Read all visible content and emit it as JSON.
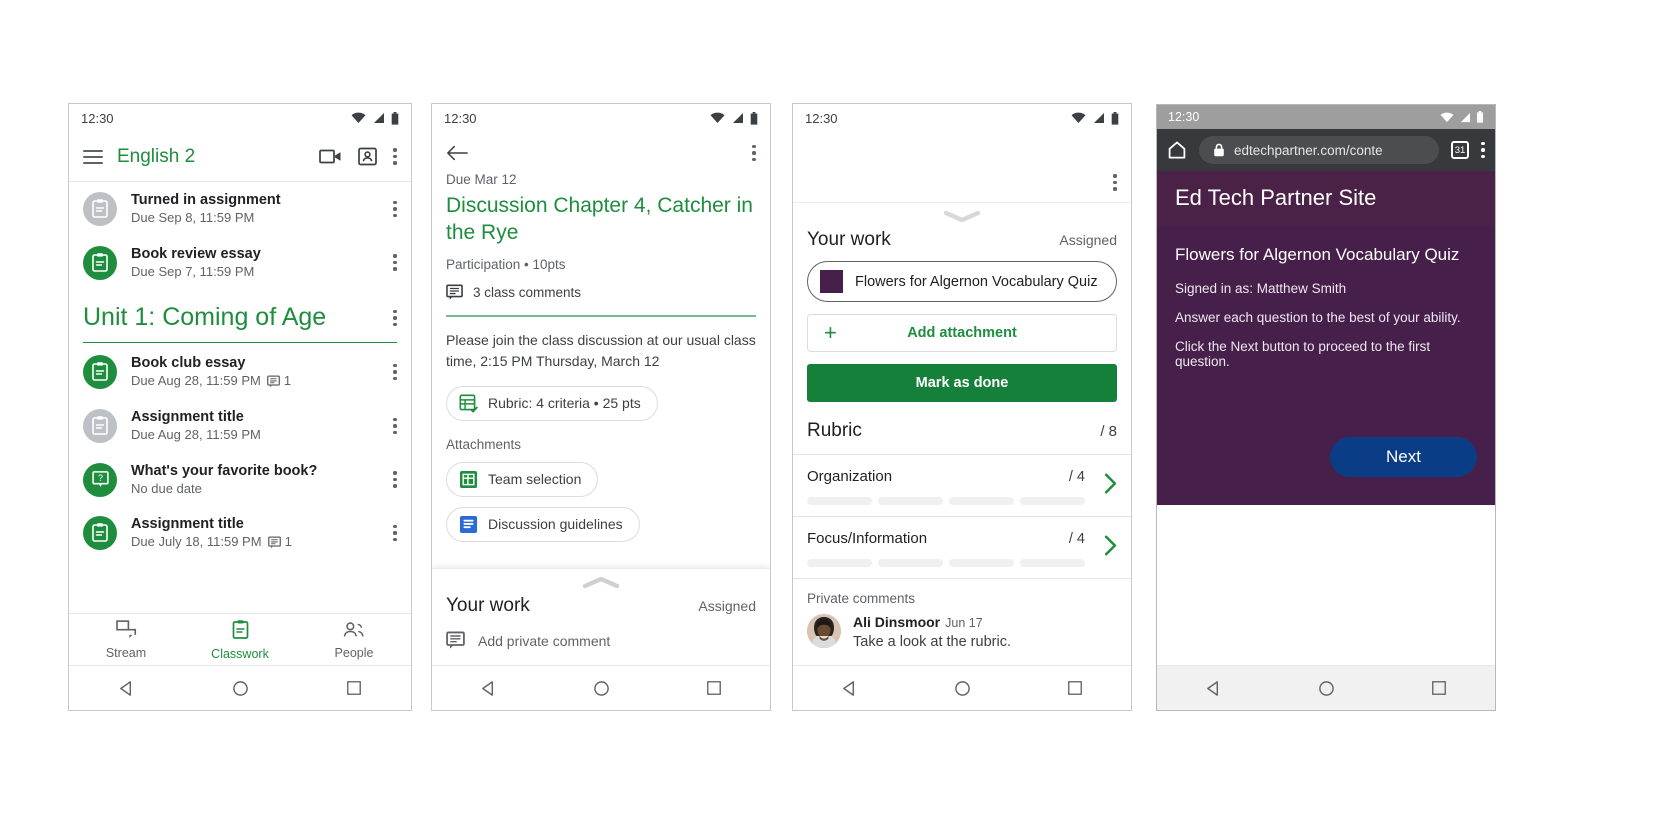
{
  "screens": {
    "classwork": {
      "status_time": "12:30",
      "appbar": {
        "title": "English 2"
      },
      "top_items": [
        {
          "title": "Turned in assignment",
          "sub": "Due Sep 8, 11:59 PM",
          "icon_color": "gray",
          "icon": "assignment-icon",
          "comments": ""
        },
        {
          "title": "Book review essay",
          "sub": "Due Sep 7, 11:59 PM",
          "icon_color": "green",
          "icon": "assignment-icon",
          "comments": ""
        }
      ],
      "unit": {
        "title": "Unit 1: Coming of Age"
      },
      "unit_items": [
        {
          "title": "Book club essay",
          "sub": "Due Aug 28, 11:59 PM",
          "icon_color": "green",
          "icon": "assignment-icon",
          "comments": "1"
        },
        {
          "title": "Assignment title",
          "sub": "Due Aug 28, 11:59 PM",
          "icon_color": "gray",
          "icon": "assignment-icon",
          "comments": ""
        },
        {
          "title": "What's your favorite book?",
          "sub": "No due date",
          "icon_color": "green",
          "icon": "question-icon",
          "comments": ""
        },
        {
          "title": "Assignment title",
          "sub": "Due July 18, 11:59 PM",
          "icon_color": "green",
          "icon": "assignment-icon",
          "comments": "1"
        }
      ],
      "tabs": [
        {
          "label": "Stream",
          "icon": "stream-icon",
          "active": false
        },
        {
          "label": "Classwork",
          "icon": "classwork-icon",
          "active": true
        },
        {
          "label": "People",
          "icon": "people-icon",
          "active": false
        }
      ]
    },
    "assignment": {
      "status_time": "12:30",
      "due": "Due Mar 12",
      "title": "Discussion Chapter 4, Catcher in the Rye",
      "meta": "Participation • 10pts",
      "class_comments": "3 class comments",
      "description": "Please join the class discussion at our usual class time, 2:15 PM Thursday, March 12",
      "rubric_chip": "Rubric: 4 criteria • 25 pts",
      "attachments_label": "Attachments",
      "attachments": [
        {
          "name": "Team selection",
          "type": "sheets"
        },
        {
          "name": "Discussion guidelines",
          "type": "docs"
        }
      ],
      "your_work": {
        "title": "Your work",
        "status": "Assigned",
        "private_comment_placeholder": "Add private comment"
      }
    },
    "studentwork": {
      "status_time": "12:30",
      "your_work": {
        "title": "Your work",
        "status": "Assigned"
      },
      "work_item": {
        "name": "Flowers for Algernon Vocabulary Quiz",
        "thumb_color": "#46204a"
      },
      "add_attachment": "Add attachment",
      "mark_as_done": "Mark as done",
      "rubric": {
        "title": "Rubric",
        "total": "/ 8",
        "criteria": [
          {
            "name": "Organization",
            "score": "/ 4",
            "levels": 4
          },
          {
            "name": "Focus/Information",
            "score": "/ 4",
            "levels": 4
          }
        ]
      },
      "private_comments": {
        "label": "Private comments",
        "items": [
          {
            "author": "Ali Dinsmoor",
            "date": "Jun 17",
            "text": "Take a look at the rubric."
          }
        ]
      }
    },
    "browser": {
      "status_time": "12:30",
      "url": "edtechpartner.com/conte",
      "tab_count": "31",
      "site_title": "Ed Tech Partner Site",
      "quiz_title": "Flowers for Algernon Vocabulary Quiz",
      "lines": [
        "Signed in as: Matthew Smith",
        "Answer each question to the best of your ability.",
        "Click the Next button to proceed to the first question."
      ],
      "next_button": "Next",
      "colors": {
        "header": "#4a2147",
        "body": "#46204a",
        "next": "#0b3d87"
      }
    }
  },
  "colors": {
    "green": "#1e8e3e",
    "dark_green": "#15803a",
    "gray_icon": "#5f6368",
    "text": "#202124"
  }
}
